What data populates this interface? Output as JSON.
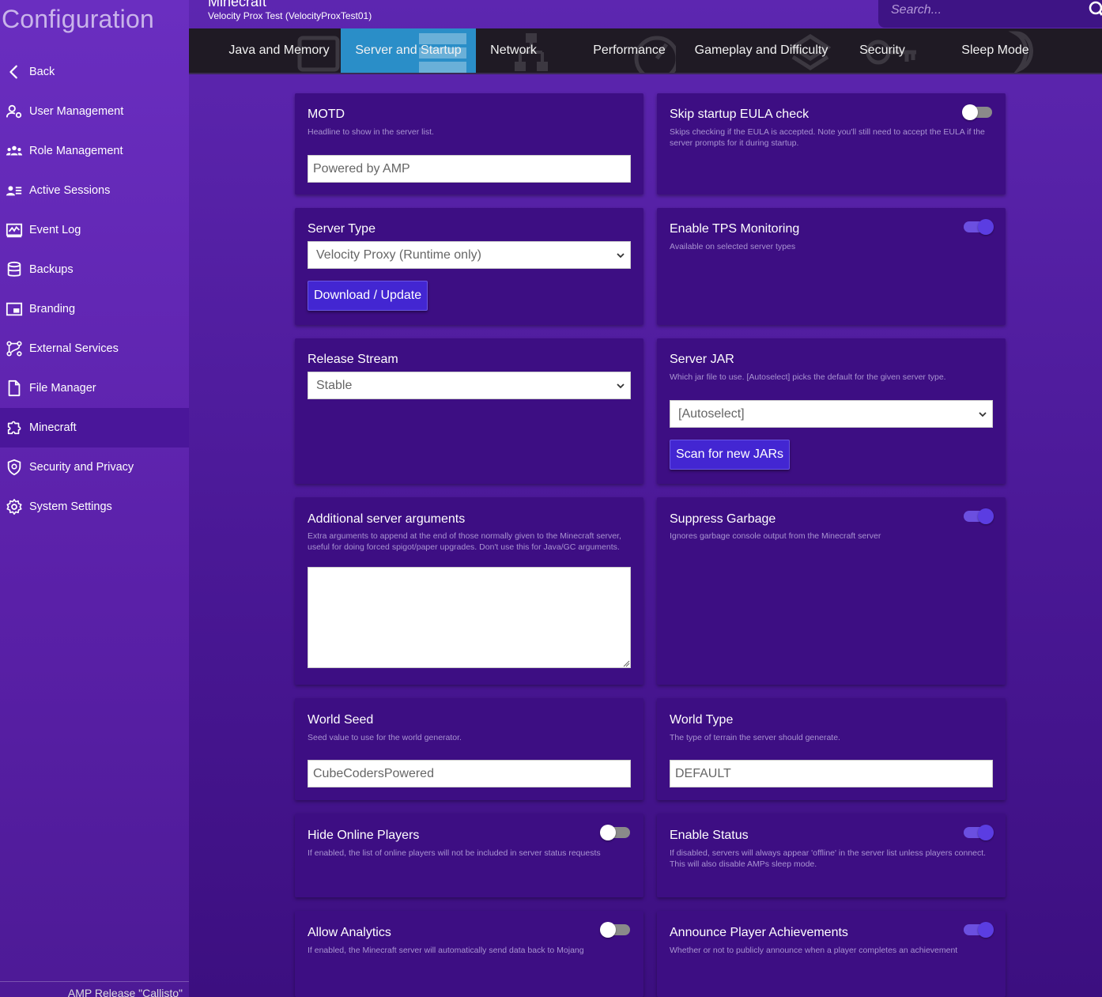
{
  "sidebar": {
    "title": "Configuration",
    "items": [
      {
        "label": "Back",
        "icon": "chevron-left-icon"
      },
      {
        "label": "User Management",
        "icon": "user-gear-icon"
      },
      {
        "label": "Role Management",
        "icon": "users-group-icon"
      },
      {
        "label": "Active Sessions",
        "icon": "user-list-icon"
      },
      {
        "label": "Event Log",
        "icon": "chart-log-icon"
      },
      {
        "label": "Backups",
        "icon": "database-icon"
      },
      {
        "label": "Branding",
        "icon": "picture-in-picture-icon"
      },
      {
        "label": "External Services",
        "icon": "nodes-icon"
      },
      {
        "label": "File Manager",
        "icon": "file-icon"
      },
      {
        "label": "Minecraft",
        "icon": "puzzle-icon"
      },
      {
        "label": "Security and Privacy",
        "icon": "shield-icon"
      },
      {
        "label": "System Settings",
        "icon": "gear-icon"
      }
    ],
    "active_index": 9,
    "footer": "AMP Release \"Callisto\""
  },
  "header": {
    "app_title": "Minecraft",
    "instance": "Velocity Prox Test (VelocityProxTest01)",
    "search_placeholder": "Search..."
  },
  "tabs": [
    {
      "label": "Java and Memory"
    },
    {
      "label": "Server and Startup"
    },
    {
      "label": "Network"
    },
    {
      "label": "Performance"
    },
    {
      "label": "Gameplay and Difficulty"
    },
    {
      "label": "Security"
    },
    {
      "label": "Sleep Mode"
    }
  ],
  "active_tab": 1,
  "settings": {
    "motd": {
      "title": "MOTD",
      "desc": "Headline to show in the server list.",
      "value": "Powered by AMP"
    },
    "eula": {
      "title": "Skip startup EULA check",
      "desc": "Skips checking if the EULA is accepted. Note you'll still need to accept the EULA if the server prompts for it during startup.",
      "enabled": false
    },
    "server_type": {
      "title": "Server Type",
      "value": "Velocity Proxy (Runtime only)",
      "button": "Download / Update"
    },
    "tps": {
      "title": "Enable TPS Monitoring",
      "desc": "Available on selected server types",
      "enabled": true
    },
    "release_stream": {
      "title": "Release Stream",
      "value": "Stable"
    },
    "server_jar": {
      "title": "Server JAR",
      "desc": "Which jar file to use. [Autoselect] picks the default for the given server type.",
      "value": "[Autoselect]",
      "button": "Scan for new JARs"
    },
    "additional_args": {
      "title": "Additional server arguments",
      "desc": "Extra arguments to append at the end of those normally given to the Minecraft server, useful for doing forced spigot/paper upgrades. Don't use this for Java/GC arguments.",
      "value": ""
    },
    "suppress_garbage": {
      "title": "Suppress Garbage",
      "desc": "Ignores garbage console output from the Minecraft server",
      "enabled": true
    },
    "world_seed": {
      "title": "World Seed",
      "desc": "Seed value to use for the world generator.",
      "value": "CubeCodersPowered"
    },
    "world_type": {
      "title": "World Type",
      "desc": "The type of terrain the server should generate.",
      "value": "DEFAULT"
    },
    "hide_players": {
      "title": "Hide Online Players",
      "desc": "If enabled, the list of online players will not be included in server status requests",
      "enabled": false
    },
    "enable_status": {
      "title": "Enable Status",
      "desc": "If disabled, servers will always appear 'offline' in the server list unless players connect. This will also disable AMPs sleep mode.",
      "enabled": true
    },
    "analytics": {
      "title": "Allow Analytics",
      "desc": "If enabled, the Minecraft server will automatically send data back to Mojang",
      "enabled": false
    },
    "achievements": {
      "title": "Announce Player Achievements",
      "desc": "Whether or not to publicly announce when a player completes an achievement",
      "enabled": true
    }
  },
  "colors": {
    "accent": "#4326d2",
    "active_tab": "#2a8ec8",
    "card": "#3d0e83",
    "toggle_on": "#5b3de2"
  }
}
